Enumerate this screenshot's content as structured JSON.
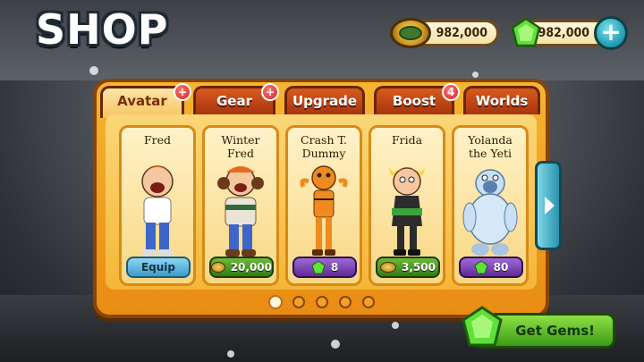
{
  "title": "SHOP",
  "currency": {
    "coins": "982,000",
    "gems": "982,000",
    "add_button_icon": "plus-icon"
  },
  "tabs": [
    {
      "label": "Avatar",
      "active": true,
      "badge": "+"
    },
    {
      "label": "Gear",
      "active": false,
      "badge": "+"
    },
    {
      "label": "Upgrade",
      "active": false,
      "badge": ""
    },
    {
      "label": "Boost",
      "active": false,
      "badge": "4"
    },
    {
      "label": "Worlds",
      "active": false,
      "badge": ""
    }
  ],
  "cards": [
    {
      "name": "Fred",
      "price": "Equip",
      "currency": "none"
    },
    {
      "name": "Winter Fred",
      "price": "20,000",
      "currency": "coin"
    },
    {
      "name": "Crash T. Dummy",
      "price": "8",
      "currency": "gem"
    },
    {
      "name": "Frida",
      "price": "3,500",
      "currency": "coin"
    },
    {
      "name": "Yolanda the Yeti",
      "price": "80",
      "currency": "gem"
    }
  ],
  "pagination": {
    "pages": 5,
    "current": 1
  },
  "get_gems_label": "Get Gems!",
  "colors": {
    "panel": "#f0a321",
    "tab": "#c0441a",
    "coin_pill": "#4a9a23",
    "gem_pill": "#7a46b5",
    "equip_pill": "#5fb6de",
    "accent_teal": "#2a93ad"
  }
}
